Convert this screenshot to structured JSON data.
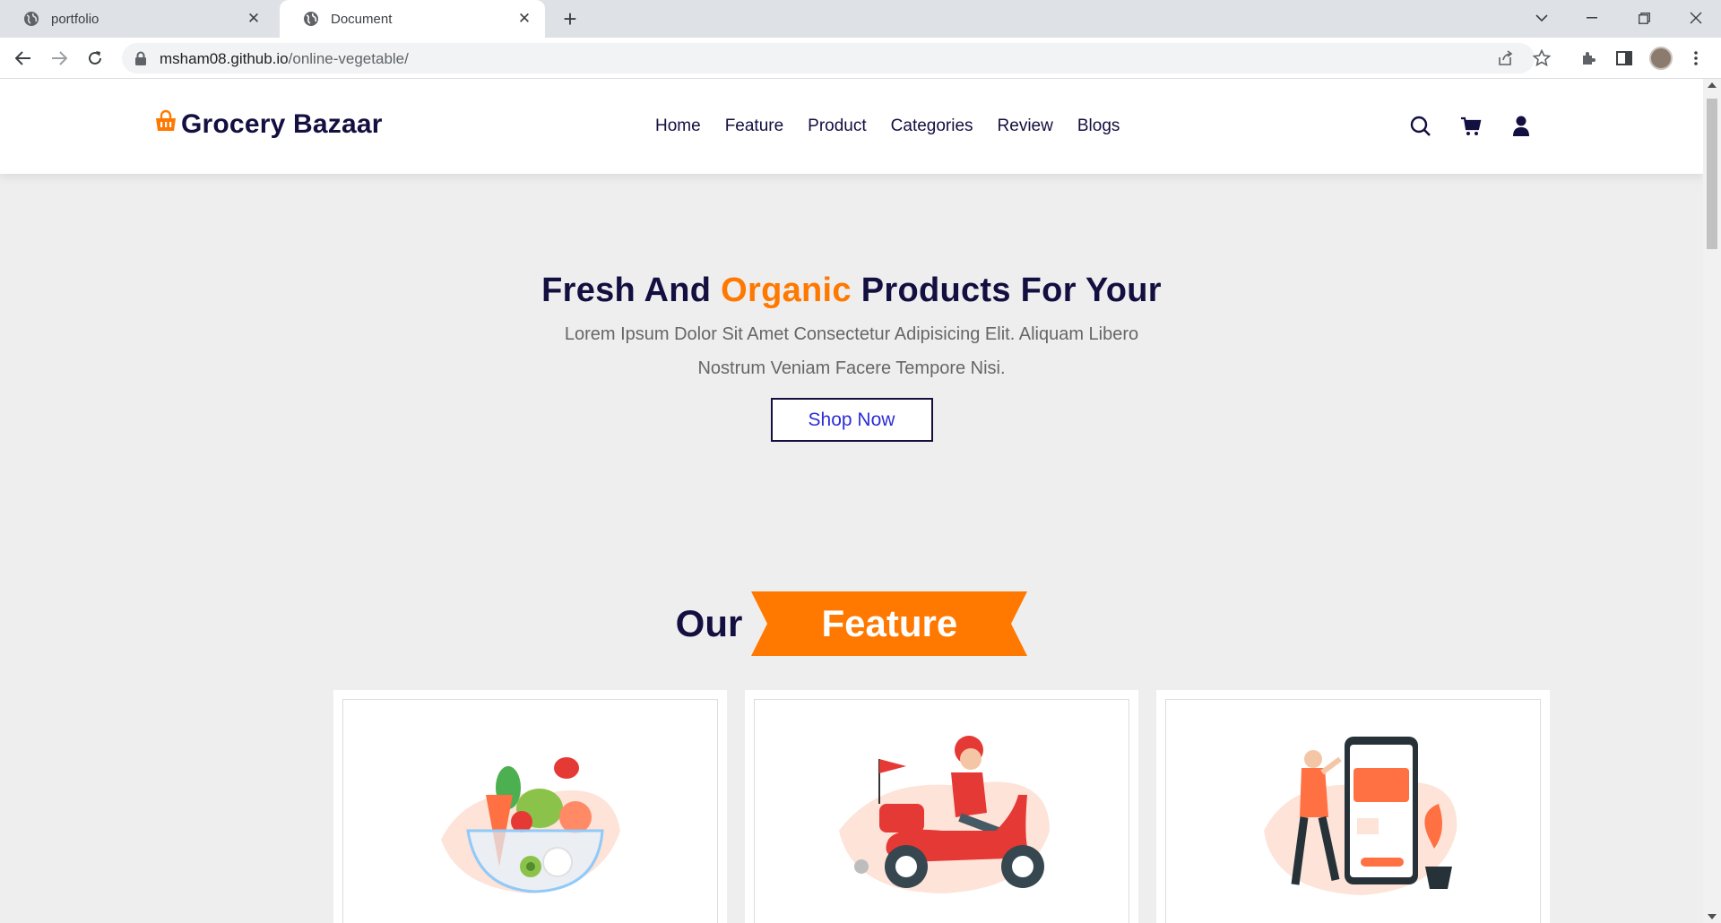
{
  "browser": {
    "tabs": [
      {
        "title": "portfolio"
      },
      {
        "title": "Document"
      }
    ],
    "url_host": "msham08.github.io",
    "url_path": "/online-vegetable/"
  },
  "site": {
    "logo_text": "Grocery Bazaar",
    "nav": [
      "Home",
      "Feature",
      "Product",
      "Categories",
      "Review",
      "Blogs"
    ],
    "icons": [
      "search-icon",
      "cart-icon",
      "user-icon"
    ]
  },
  "hero": {
    "title_pre": "Fresh And ",
    "title_accent": "Organic",
    "title_post": " Products For Your",
    "subtitle": "Lorem Ipsum Dolor Sit Amet Consectetur Adipisicing Elit. Aliquam Libero Nostrum Veniam Facere Tempore Nisi.",
    "button": "Shop Now"
  },
  "feature": {
    "heading_pre": "Our",
    "heading_badge": "Feature",
    "cards": [
      {
        "image": "vegetable-bowl-illustration"
      },
      {
        "image": "delivery-scooter-illustration"
      },
      {
        "image": "mobile-payment-illustration"
      }
    ]
  },
  "colors": {
    "brand_dark": "#130f40",
    "accent": "#ff7800",
    "page_bg": "#eeeeee"
  }
}
